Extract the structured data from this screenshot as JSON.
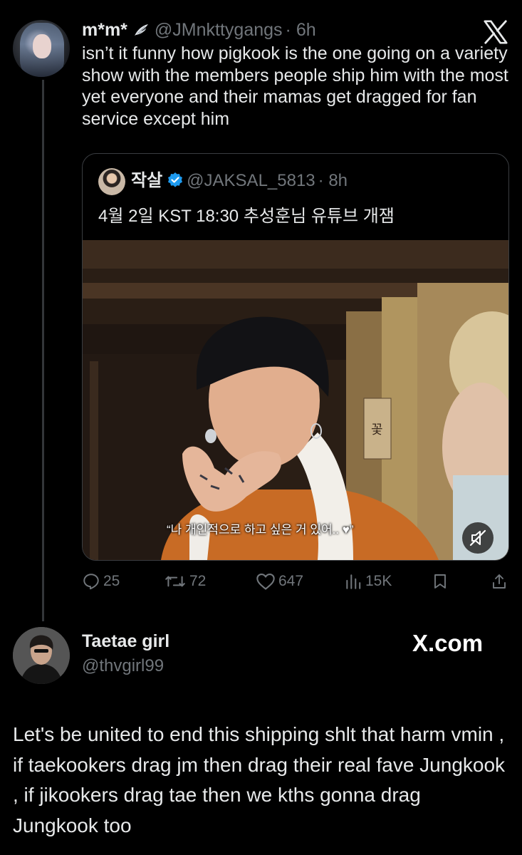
{
  "tweet1": {
    "display_name": "m*m*",
    "handle": "@JMnkttygangs",
    "time": "· 6h",
    "text": "isn’t it funny how pigkook is the one going on a variety show with the members people ship him with the most yet everyone and their mamas get dragged for fan service except him"
  },
  "quote": {
    "display_name": "작살",
    "handle": "@JAKSAL_5813",
    "time": "· 8h",
    "text": "4월 2일 KST 18:30 추성훈님 유튜브 개잼",
    "video_caption": "“나 개인적으로 하고 싶은 거 있어.. ♥”",
    "sign_text": "꽃"
  },
  "actions": {
    "replies": "25",
    "retweets": "72",
    "likes": "647",
    "views": "15K"
  },
  "tweet2": {
    "display_name": "Taetae girl",
    "handle": "@thvgirl99",
    "brand": "X.com",
    "text": "Let's be united to end this shipping shlt that harm vmin , if taekookers drag jm then drag their real fave Jungkook , if jikookers drag tae then we kths gonna drag Jungkook too"
  },
  "colors": {
    "background": "#000000",
    "text": "#e7e9ea",
    "muted": "#71767b",
    "verified": "#1d9bf0",
    "border": "#3a3d41"
  }
}
